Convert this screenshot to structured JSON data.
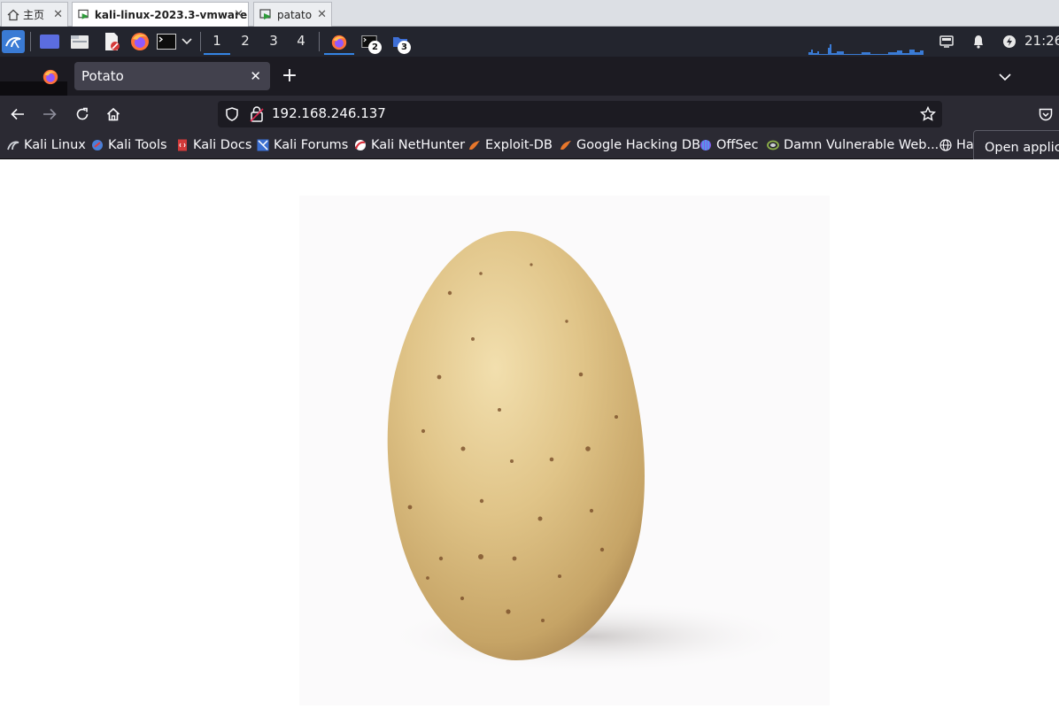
{
  "host": {
    "tabs": [
      {
        "label": "主页",
        "icon": "home-icon"
      },
      {
        "label": "kali-linux-2023.3-vmware...",
        "icon": "vm-icon",
        "active": true
      },
      {
        "label": "patato",
        "icon": "vm-icon"
      }
    ],
    "close_glyph": "✕"
  },
  "panel": {
    "workspaces": [
      "1",
      "2",
      "3",
      "4"
    ],
    "badges": [
      "2",
      "3"
    ],
    "clock": "21:26",
    "accent": "#3584e4"
  },
  "browser": {
    "tab_title": "Potato",
    "new_tab_glyph": "+",
    "url": "192.168.246.137",
    "bookmarks": [
      {
        "label": "Kali Linux",
        "icon": "kali-dragon-icon",
        "color": "#cfd2d8"
      },
      {
        "label": "Kali Tools",
        "icon": "kali-tools-icon",
        "color": "#4a7fd8"
      },
      {
        "label": "Kali Docs",
        "icon": "kali-docs-icon",
        "color": "#d23a3a"
      },
      {
        "label": "Kali Forums",
        "icon": "kali-forums-icon",
        "color": "#3b6fd1"
      },
      {
        "label": "Kali NetHunter",
        "icon": "nethunter-icon",
        "color": "#d9303c"
      },
      {
        "label": "Exploit-DB",
        "icon": "exploit-db-icon",
        "color": "#e8772b"
      },
      {
        "label": "Google Hacking DB",
        "icon": "ghdb-icon",
        "color": "#e8772b"
      },
      {
        "label": "OffSec",
        "icon": "offsec-icon",
        "color": "#7d5de6"
      },
      {
        "label": "Damn Vulnerable Web...",
        "icon": "dvwa-icon",
        "color": "#8fb34a"
      },
      {
        "label": "Hack",
        "icon": "globe-icon",
        "color": "#fbfbfe"
      }
    ],
    "tooltip": "Open applica"
  },
  "page": {
    "image_icon": "potato-image"
  }
}
